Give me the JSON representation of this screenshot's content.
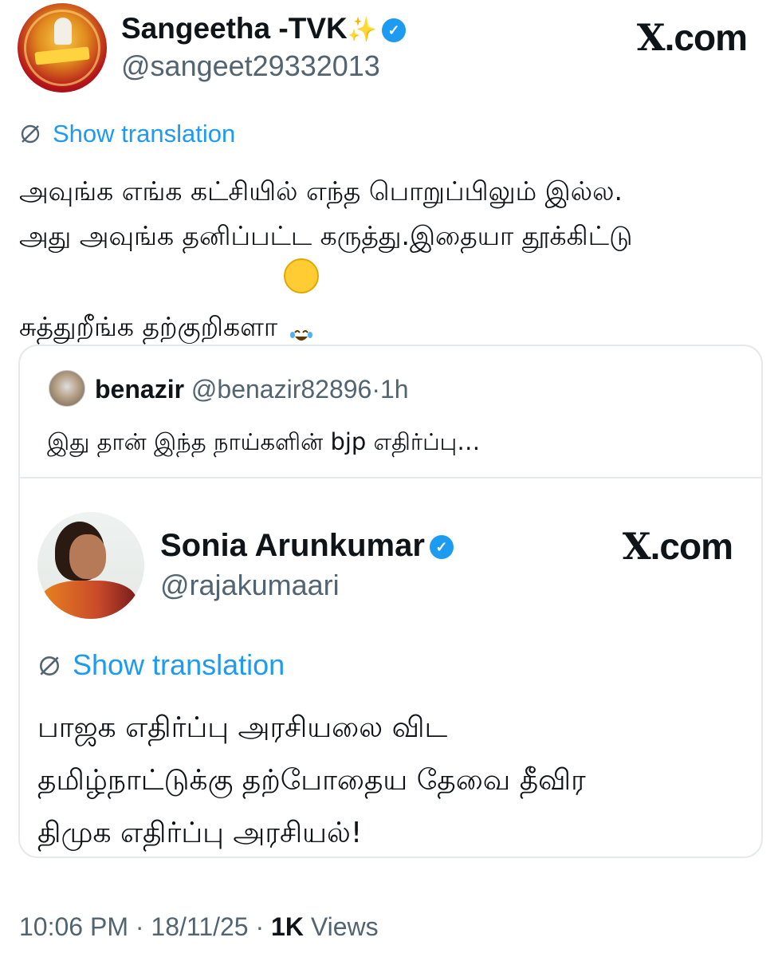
{
  "header": {
    "display_name": "Sangeetha -TVK",
    "handle": "@sangeet29332013",
    "brand": "X.com",
    "brand_x": "X",
    "brand_suffix": ".com",
    "verified_icon": "verified-badge-icon",
    "sparkle": "✨"
  },
  "post": {
    "translate_label": "Show translation",
    "text": "அவுங்க எங்க கட்சியில் எந்த பொறுப்பிலும் இல்ல.\nஅது அவுங்க தனிப்பட்ட கருத்து.இதையா தூக்கிட்டு\nசுத்துறீங்க தற்குறிகளா",
    "emoji": "😂"
  },
  "quote": {
    "name": "benazir",
    "handle": "@benazir82896",
    "separator": "·",
    "age": "1h",
    "text": "இது தான் இந்த நாய்களின் bjp எதிர்ப்பு…",
    "inner": {
      "name": "Sonia Arunkumar",
      "handle": "@rajakumaari",
      "brand_x": "X",
      "brand_suffix": ".com",
      "translate_label": "Show translation",
      "text": "பாஜக எதிர்ப்பு அரசியலை விட\nதமிழ்நாட்டுக்கு தற்போதைய தேவை தீவிர\nதிமுக எதிர்ப்பு அரசியல்!"
    }
  },
  "footer": {
    "time": "10:06 PM",
    "sep1": "·",
    "date": "18/11/25",
    "sep2": "·",
    "views_count": "1K",
    "views_label": "Views"
  },
  "colors": {
    "link": "#1d9bf0",
    "muted": "#536471",
    "text": "#0f1419",
    "border": "#e6e9ec"
  }
}
